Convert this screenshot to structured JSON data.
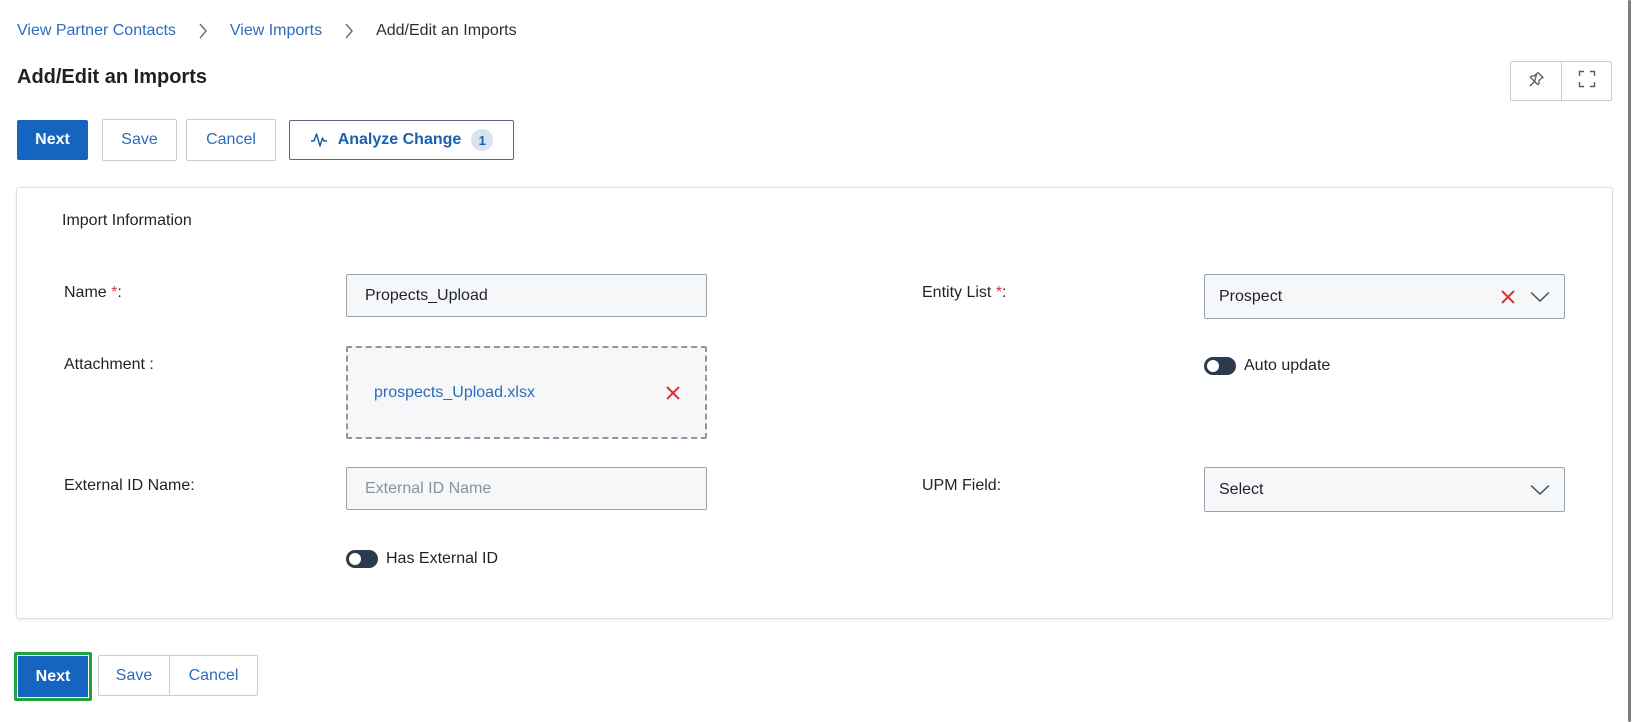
{
  "breadcrumb": {
    "items": [
      "View Partner Contacts",
      "View Imports"
    ],
    "current": "Add/Edit an Imports"
  },
  "page": {
    "title": "Add/Edit an Imports"
  },
  "toolbar": {
    "next_label": "Next",
    "save_label": "Save",
    "cancel_label": "Cancel",
    "analyze_label": "Analyze Change",
    "analyze_count": "1"
  },
  "view_tools": {
    "pin_icon": "pin-icon",
    "fullscreen_icon": "expand-icon"
  },
  "form": {
    "section_title": "Import Information",
    "name": {
      "label": "Name ",
      "required": "*",
      "suffix": ":",
      "value": "Propects_Upload"
    },
    "attachment": {
      "label": "Attachment :",
      "file_name": "prospects_Upload.xlsx"
    },
    "external_id_name": {
      "label": "External ID Name:",
      "placeholder": "External ID Name",
      "value": ""
    },
    "has_external_id": {
      "label": "Has External ID",
      "on": false
    },
    "entity_list": {
      "label": "Entity List ",
      "required": "*",
      "suffix": ":",
      "value": "Prospect"
    },
    "auto_update": {
      "label": "Auto update",
      "on": false
    },
    "upm_field": {
      "label": "UPM Field:",
      "value": "Select"
    }
  },
  "footer": {
    "next_label": "Next",
    "save_label": "Save",
    "cancel_label": "Cancel"
  },
  "colors": {
    "primary": "#1565c0",
    "link": "#2d6cbb",
    "danger": "#d9363e",
    "focus": "#1fa33b",
    "toggle": "#2c3a4d"
  }
}
